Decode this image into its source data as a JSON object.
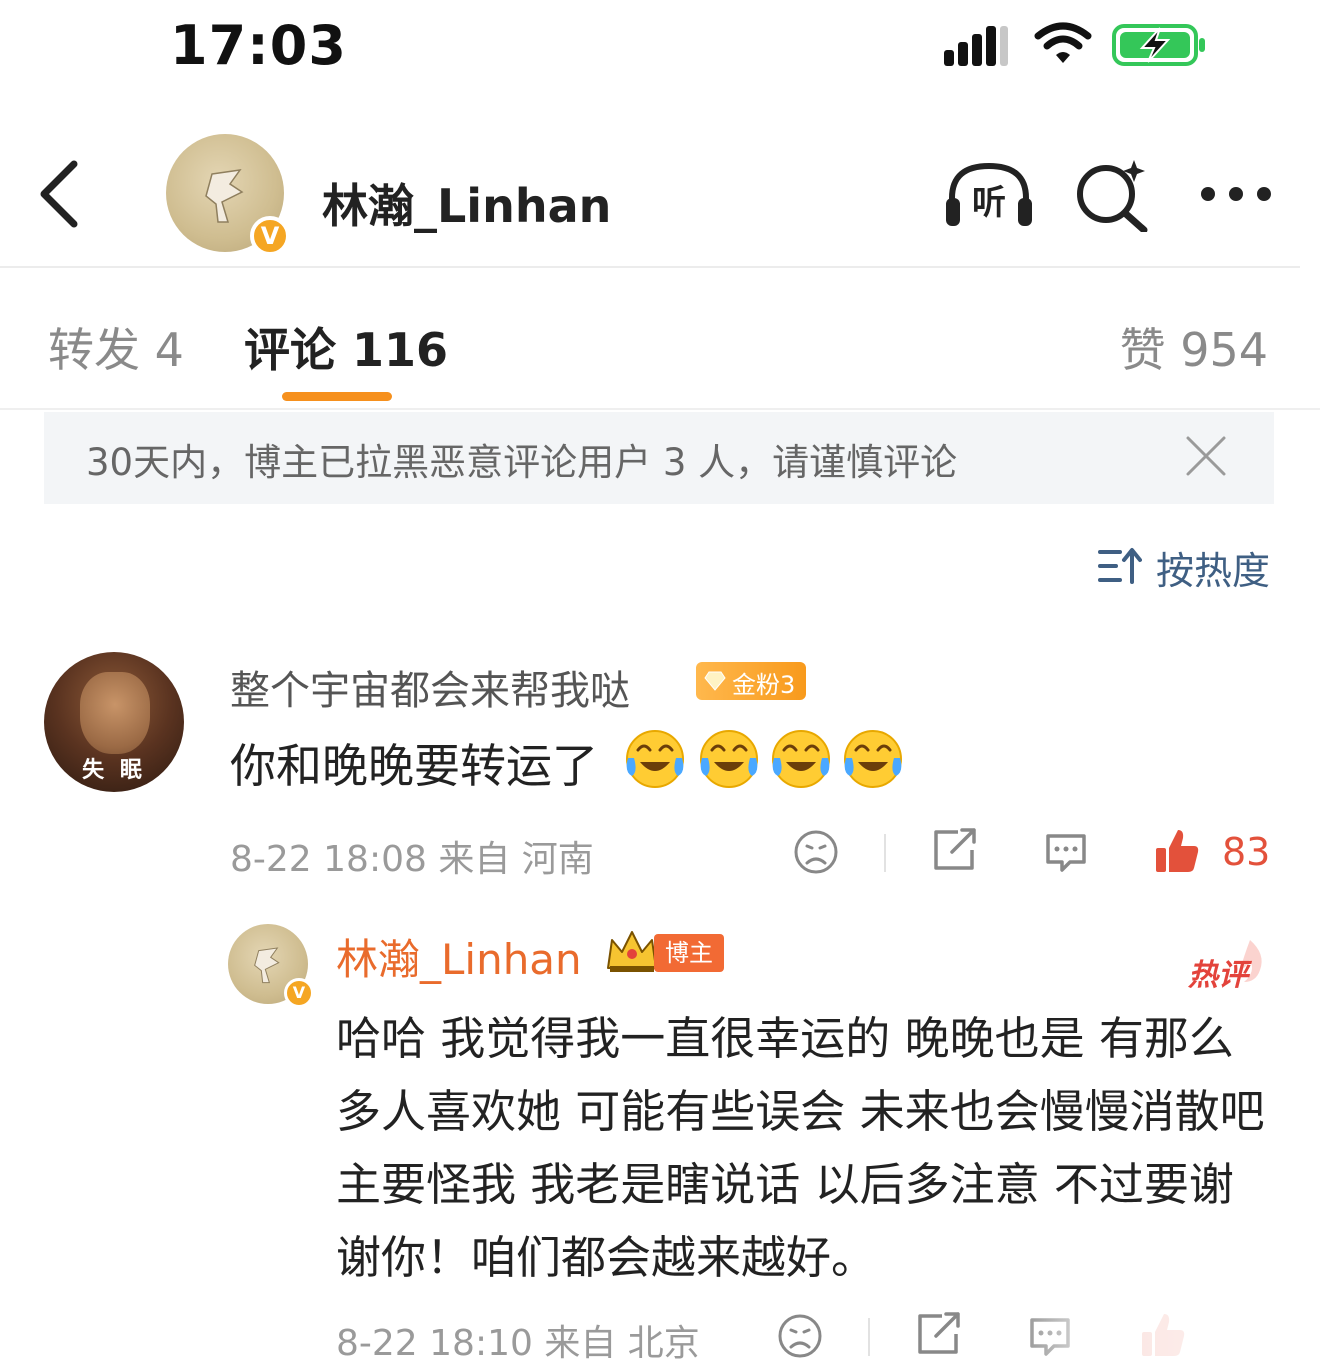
{
  "status_bar": {
    "time": "17:03",
    "icons": [
      "signal-icon",
      "wifi-icon",
      "battery-charging-icon"
    ],
    "battery_color": "#34c759"
  },
  "header": {
    "name": "林瀚_Linhan",
    "verified_mark": "V",
    "icons": [
      "back-icon",
      "listen-icon",
      "search-icon",
      "more-icon"
    ],
    "listen_label": "听"
  },
  "tabs": [
    {
      "label": "转发 4",
      "active": false
    },
    {
      "label": "评论 116",
      "active": true
    },
    {
      "label": "赞 954",
      "active": false
    }
  ],
  "accent_color": "#f6901d",
  "notice": {
    "text": "30天内，博主已拉黑恶意评论用户 3 人，请谨慎评论"
  },
  "sort": {
    "label": "按热度"
  },
  "comment": {
    "username": "整个宇宙都会来帮我哒",
    "avatar_caption": "失 眠",
    "fan_badge": "金粉3",
    "text": "你和晚晚要转运了",
    "emoji": "laugh-cry-emoji",
    "emoji_count": 4,
    "meta": "8-22 18:08 来自 河南",
    "like_count": "83",
    "like_color": "#e3513b"
  },
  "reply": {
    "username": "林瀚_Linhan",
    "badge": "博主",
    "hot_label": "热评",
    "text": "哈哈 我觉得我一直很幸运的 晚晚也是 有那么多人喜欢她 可能有些误会 未来也会慢慢消散吧 主要怪我 我老是瞎说话 以后多注意 不过要谢谢你！咱们都会越来越好。",
    "meta": "8-22 18:10 来自 北京",
    "name_color": "#e96b2c"
  }
}
